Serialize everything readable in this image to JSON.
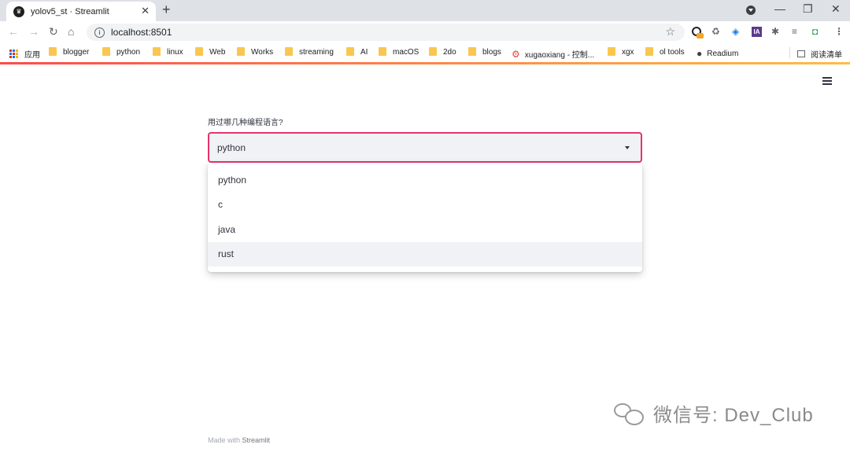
{
  "browser": {
    "tab_title": "yolov5_st · Streamlit",
    "tab_close": "✕",
    "new_tab": "+",
    "window_controls": {
      "minimize": "—",
      "restore": "❐",
      "close": "✕"
    },
    "url": "localhost:8501",
    "nav": {
      "back": "←",
      "forward": "→",
      "reload": "↻",
      "home": "⌂"
    },
    "bookmark_star": "☆",
    "bookmarks": [
      {
        "label": "应用",
        "icon": "apps-grid-icon"
      },
      {
        "label": "blogger",
        "icon": "folder-icon"
      },
      {
        "label": "python",
        "icon": "folder-icon"
      },
      {
        "label": "linux",
        "icon": "folder-icon"
      },
      {
        "label": "Web",
        "icon": "folder-icon"
      },
      {
        "label": "Works",
        "icon": "folder-icon"
      },
      {
        "label": "streaming",
        "icon": "folder-icon"
      },
      {
        "label": "AI",
        "icon": "folder-icon"
      },
      {
        "label": "macOS",
        "icon": "folder-icon"
      },
      {
        "label": "2do",
        "icon": "folder-icon"
      },
      {
        "label": "blogs",
        "icon": "folder-icon"
      },
      {
        "label": "xugaoxiang - 控制...",
        "icon": "gear-icon"
      },
      {
        "label": "xgx",
        "icon": "folder-icon"
      },
      {
        "label": "ol tools",
        "icon": "folder-icon"
      },
      {
        "label": "Readium",
        "icon": "globe-icon"
      },
      {
        "label": "阅读清单",
        "icon": "reading-list-icon"
      }
    ]
  },
  "app": {
    "accent_color": "#e8336b",
    "select_label": "用过哪几种编程语言?",
    "selected_value": "python",
    "options": [
      "python",
      "c",
      "java",
      "rust"
    ],
    "hovered_option": "rust",
    "footer_prefix": "Made with ",
    "footer_brand": "Streamlit"
  },
  "watermark": {
    "text": "微信号: Dev_Club",
    "icon": "wechat-icon"
  }
}
